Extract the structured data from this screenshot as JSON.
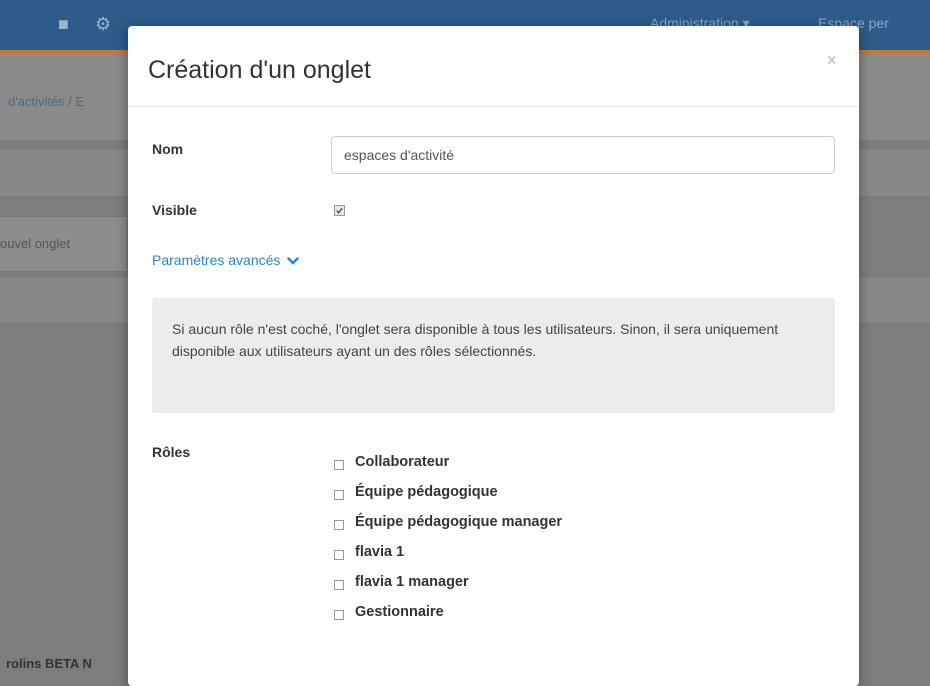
{
  "background": {
    "topbar": {
      "admin_menu": "Administration ▾",
      "personal_space": "Espace per"
    },
    "breadcrumb": "d'activités / E",
    "tab_label": "ouvel onglet",
    "footer_text": "rolins BETA N"
  },
  "modal": {
    "title": "Création d'un onglet",
    "close": "×",
    "name_label": "Nom",
    "name_value": "espaces d'activité",
    "visible_label": "Visible",
    "visible_checked": true,
    "advanced_label": "Paramètres avancés",
    "info_text": "Si aucun rôle n'est coché, l'onglet sera disponible à tous les utilisateurs. Sinon, il sera uniquement disponible aux utilisateurs ayant un des rôles sélectionnés.",
    "roles_label": "Rôles",
    "roles": [
      {
        "label": "Collaborateur",
        "checked": false
      },
      {
        "label": "Équipe pédagogique",
        "checked": false
      },
      {
        "label": "Équipe pédagogique manager",
        "checked": false
      },
      {
        "label": "flavia 1",
        "checked": false
      },
      {
        "label": "flavia 1 manager",
        "checked": false
      },
      {
        "label": "Gestionnaire",
        "checked": false
      }
    ]
  },
  "colors": {
    "link": "#2b86c5",
    "topbar": "#2d5b8a",
    "overlay": "#7d7d7d"
  }
}
